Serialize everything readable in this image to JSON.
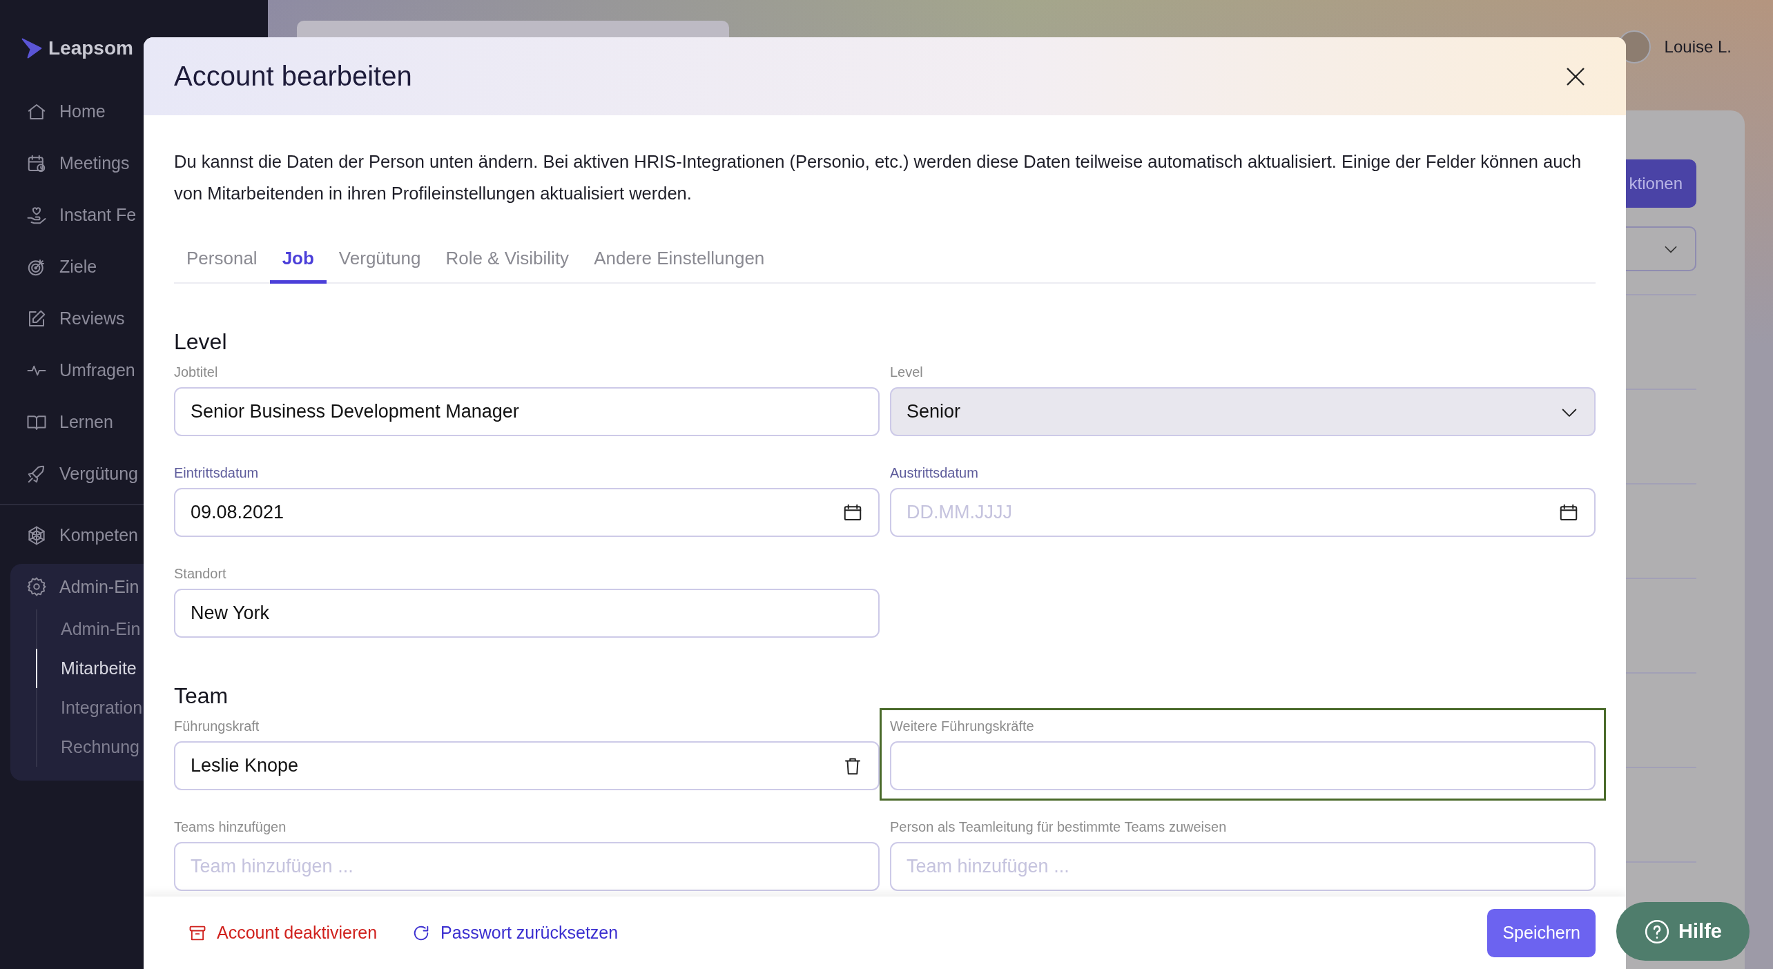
{
  "sidebar": {
    "logo": "Leapsom",
    "sections": [
      {
        "items": [
          {
            "label": "Home",
            "selected": false
          },
          {
            "label": "Meetings",
            "selected": false
          },
          {
            "label": "Instant Fe",
            "selected": false
          },
          {
            "label": "Ziele",
            "selected": false
          },
          {
            "label": "Reviews",
            "selected": false
          },
          {
            "label": "Umfragen",
            "selected": false
          },
          {
            "label": "Lernen",
            "selected": false
          },
          {
            "label": "Vergütung",
            "selected": false
          }
        ]
      },
      {
        "items": [
          {
            "label": "Kompeten",
            "selected": false
          },
          {
            "label": "Admin-Ein",
            "selected": false,
            "expanded": true,
            "children": [
              {
                "label": "Admin-Ein",
                "selected": false
              },
              {
                "label": "Mitarbeite",
                "selected": true
              },
              {
                "label": "Integration",
                "selected": false
              },
              {
                "label": "Rechnung",
                "selected": false
              }
            ]
          }
        ]
      }
    ]
  },
  "topbar": {
    "user": "Louise L."
  },
  "background_card": {
    "button": "ktionen"
  },
  "dialog": {
    "title": "Account bearbeiten",
    "description": "Du kannst die Daten der Person unten ändern. Bei aktiven HRIS-Integrationen (Personio, etc.) werden diese Daten teilweise automatisch aktualisiert. Einige der Felder können auch von Mitarbeitenden in ihren Profileinstellungen aktualisiert werden.",
    "tabs": [
      {
        "label": "Personal",
        "selected": false
      },
      {
        "label": "Job",
        "selected": true
      },
      {
        "label": "Vergütung",
        "selected": false
      },
      {
        "label": "Role & Visibility",
        "selected": false
      },
      {
        "label": "Andere Einstellungen",
        "selected": false
      }
    ],
    "sections": [
      {
        "heading": "Level",
        "rows": [
          [
            {
              "label": "Jobtitel",
              "kind": "text",
              "value": "Senior Business Development Manager",
              "focused": false
            },
            {
              "label": "Level",
              "kind": "select",
              "value": "Senior",
              "focused": false
            }
          ],
          [
            {
              "label": "Eintrittsdatum",
              "kind": "date",
              "value": "09.08.2021",
              "focused": false
            },
            {
              "label": "Austrittsdatum",
              "kind": "date",
              "placeholder": "DD.MM.JJJJ",
              "focused": false
            }
          ],
          [
            {
              "label": "Standort",
              "kind": "text",
              "value": "New York",
              "focused": false
            }
          ]
        ]
      },
      {
        "heading": "Team",
        "rows": [
          [
            {
              "label": "Führungskraft",
              "kind": "person",
              "value": "Leslie Knope",
              "focused": false
            },
            {
              "label": "Weitere Führungskräfte",
              "kind": "text",
              "focused": true
            }
          ],
          [
            {
              "label": "Teams hinzufügen",
              "kind": "text",
              "placeholder": "Team hinzufügen ...",
              "focused": false
            },
            {
              "label": "Person als Teamleitung für bestimmte Teams zuweisen",
              "kind": "text",
              "placeholder": "Team hinzufügen ...",
              "focused": false
            }
          ]
        ]
      }
    ],
    "footer": {
      "actions": [
        {
          "label": "Account deaktivieren",
          "kind": "danger"
        },
        {
          "label": "Passwort zurücksetzen",
          "kind": "link"
        }
      ],
      "save": "Speichern"
    }
  },
  "help_button": "Hilfe"
}
